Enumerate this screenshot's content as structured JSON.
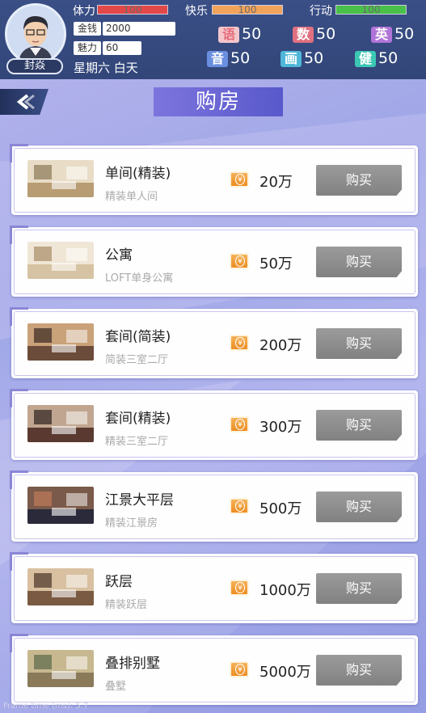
{
  "player": {
    "name": "封焱"
  },
  "stats": [
    {
      "label": "体力",
      "value": "100",
      "percent": 100,
      "color": "#e34848"
    },
    {
      "label": "快乐",
      "value": "100",
      "percent": 100,
      "color": "#f2a35a"
    },
    {
      "label": "行动",
      "value": "100",
      "percent": 100,
      "color": "#49c04a"
    }
  ],
  "money": {
    "label": "金钱",
    "value": "2000"
  },
  "charm": {
    "label": "魅力",
    "value": "60"
  },
  "day_text": "星期六 白天",
  "skills": [
    {
      "label": "语",
      "value": "50",
      "color": "#e66b7a"
    },
    {
      "label": "数",
      "value": "50",
      "color": "#e66b7a"
    },
    {
      "label": "英",
      "value": "50",
      "color": "#b074d8"
    },
    {
      "label": "音",
      "value": "50",
      "color": "#6a8ee0"
    },
    {
      "label": "画",
      "value": "50",
      "color": "#4fb7d8"
    },
    {
      "label": "健",
      "value": "50",
      "color": "#3cc7b4"
    }
  ],
  "title": "购房",
  "houses": [
    {
      "name": "单间(精装)",
      "desc": "精装单人间",
      "price": "20万",
      "buy": "购买",
      "thumb": "room-icon"
    },
    {
      "name": "公寓",
      "desc": "LOFT单身公寓",
      "price": "50万",
      "buy": "购买",
      "thumb": "apartment-icon"
    },
    {
      "name": "套间(简装)",
      "desc": "简装三室二厅",
      "price": "200万",
      "buy": "购买",
      "thumb": "suite-icon"
    },
    {
      "name": "套间(精装)",
      "desc": "精装三室二厅",
      "price": "300万",
      "buy": "购买",
      "thumb": "suite-deluxe-icon"
    },
    {
      "name": "江景大平层",
      "desc": "精装江景房",
      "price": "500万",
      "buy": "购买",
      "thumb": "river-view-icon"
    },
    {
      "name": "跃层",
      "desc": "精装跃层",
      "price": "1000万",
      "buy": "购买",
      "thumb": "duplex-icon"
    },
    {
      "name": "叠排别墅",
      "desc": "叠墅",
      "price": "5000万",
      "buy": "购买",
      "thumb": "villa-icon"
    }
  ],
  "footer": "Frame time (ms):  5.7"
}
